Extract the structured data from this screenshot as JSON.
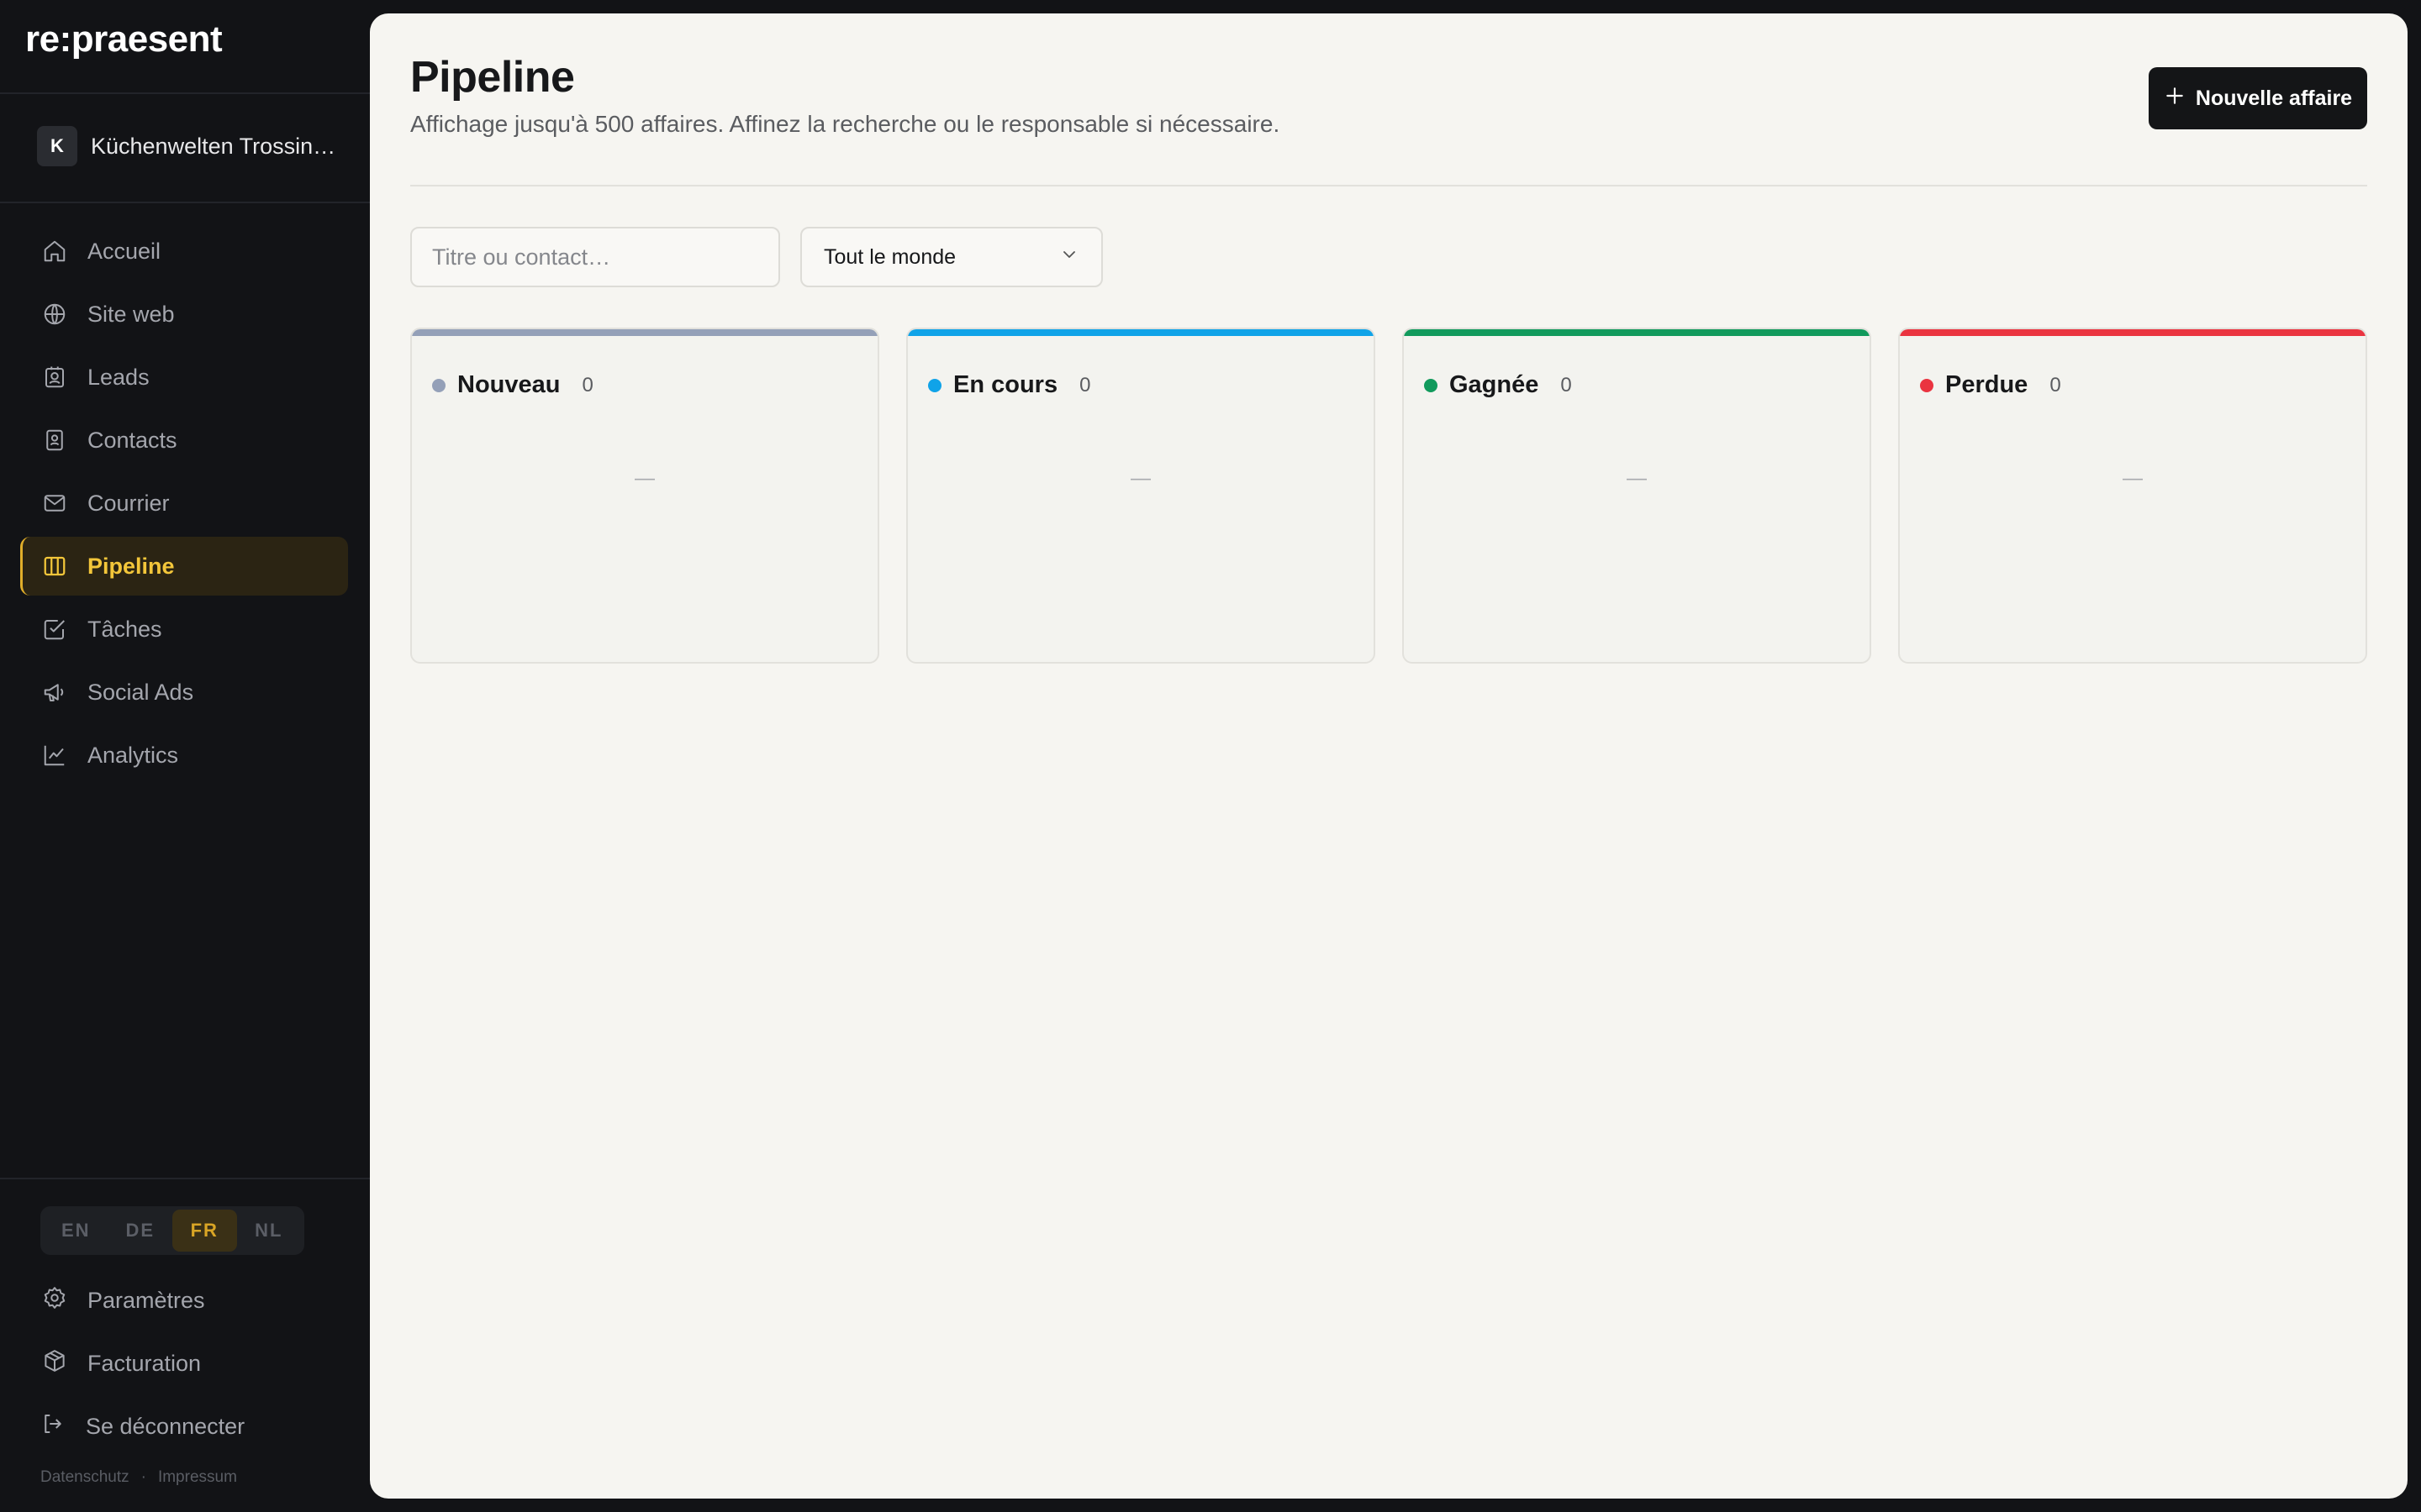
{
  "app": {
    "logo": "re:praesent"
  },
  "workspace": {
    "initial": "K",
    "name": "Küchenwelten Trossingen"
  },
  "nav": {
    "items": [
      {
        "label": "Accueil",
        "icon": "home-icon"
      },
      {
        "label": "Site web",
        "icon": "globe-icon"
      },
      {
        "label": "Leads",
        "icon": "contact-card-icon"
      },
      {
        "label": "Contacts",
        "icon": "address-book-icon"
      },
      {
        "label": "Courrier",
        "icon": "mail-icon"
      },
      {
        "label": "Pipeline",
        "icon": "columns-icon",
        "active": true
      },
      {
        "label": "Tâches",
        "icon": "checkbox-icon"
      },
      {
        "label": "Social Ads",
        "icon": "megaphone-icon"
      },
      {
        "label": "Analytics",
        "icon": "line-chart-icon"
      }
    ]
  },
  "languages": {
    "options": [
      "EN",
      "DE",
      "FR",
      "NL"
    ],
    "selected": "FR"
  },
  "footer": {
    "settings": "Paramètres",
    "billing": "Facturation",
    "logout": "Se déconnecter",
    "privacy": "Datenschutz",
    "separator": "·",
    "imprint": "Impressum"
  },
  "page": {
    "title": "Pipeline",
    "subtitle": "Affichage jusqu'à 500 affaires. Affinez la recherche ou le responsable si nécessaire.",
    "new_button": "Nouvelle affaire"
  },
  "filters": {
    "search_placeholder": "Titre ou contact…",
    "search_value": "",
    "owner_selected": "Tout le monde"
  },
  "columns": [
    {
      "title": "Nouveau",
      "count": "0",
      "color": "#94a0b8",
      "empty": "—"
    },
    {
      "title": "En cours",
      "count": "0",
      "color": "#10a3e8",
      "empty": "—"
    },
    {
      "title": "Gagnée",
      "count": "0",
      "color": "#119a5c",
      "empty": "—"
    },
    {
      "title": "Perdue",
      "count": "0",
      "color": "#ea3440",
      "empty": "—"
    }
  ],
  "colors": {
    "accent": "#f3c63a",
    "sidebar_bg": "#121316",
    "main_bg": "#f6f5f1",
    "primary_button": "#141517"
  }
}
